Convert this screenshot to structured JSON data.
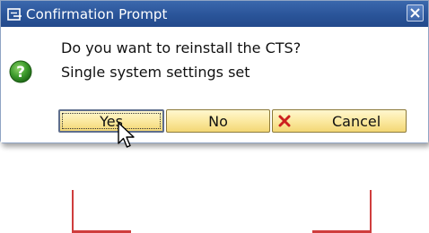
{
  "dialog": {
    "title": "Confirmation Prompt",
    "messages": [
      "Do you want to reinstall the CTS?",
      "Single system settings set"
    ],
    "buttons": {
      "yes": "Yes",
      "no": "No",
      "cancel": "Cancel"
    },
    "icons": {
      "title": "window-prompt-icon",
      "close": "close-icon",
      "message": "question-icon",
      "cancel": "red-x-icon"
    }
  },
  "colors": {
    "titlebar": "#2a5499",
    "button_fill": "#fbe9a1",
    "question_icon": "#3c9a2c",
    "cancel_x": "#cc1f1f",
    "guide_lines": "#cf3d3d"
  }
}
